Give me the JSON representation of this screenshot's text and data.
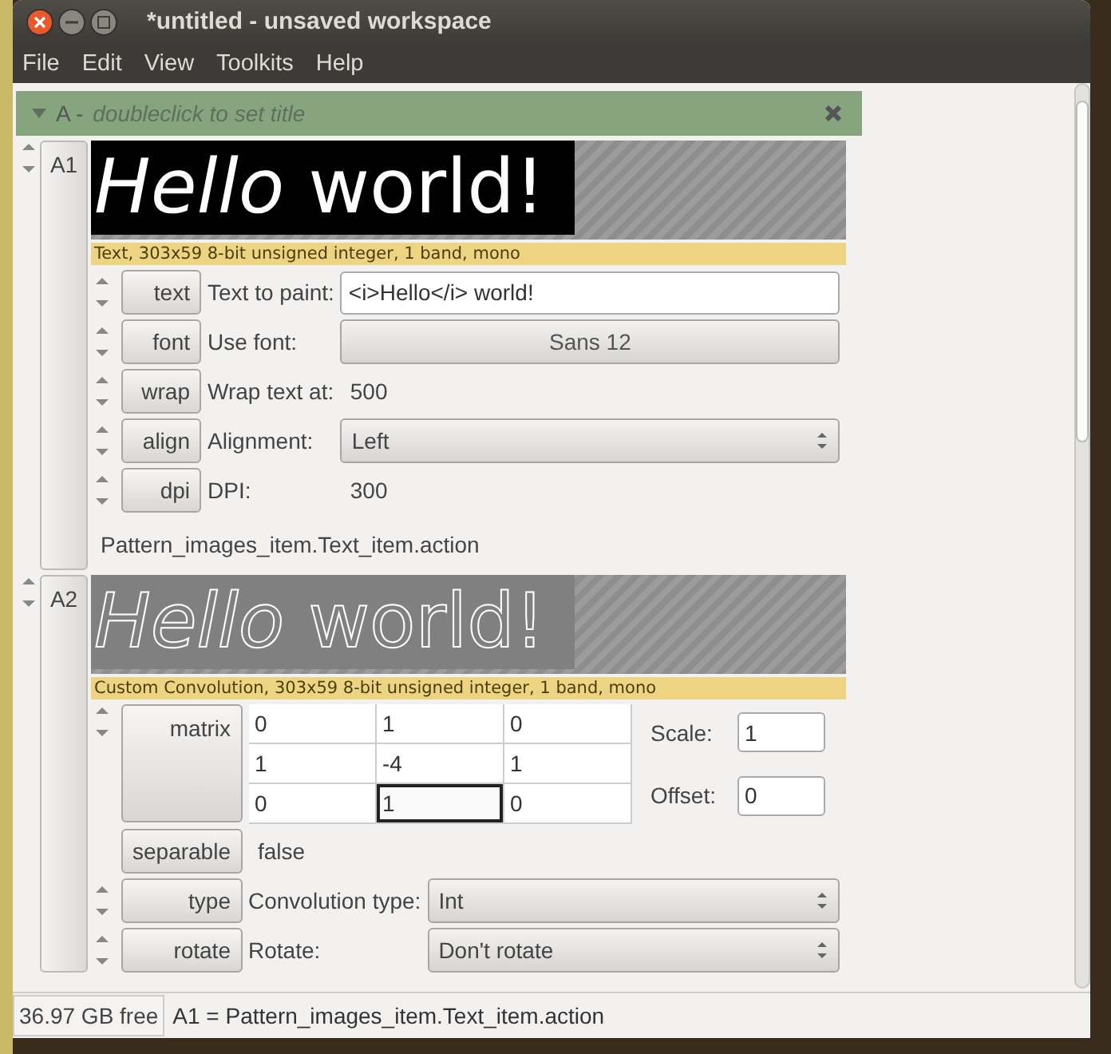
{
  "window": {
    "title": "*untitled - unsaved workspace"
  },
  "menu": [
    "File",
    "Edit",
    "View",
    "Toolkits",
    "Help"
  ],
  "workspace": {
    "prefix": "A -",
    "title_placeholder": "doubleclick to set title"
  },
  "items": [
    {
      "id_label": "A1",
      "kind": "solid",
      "image_text": "*Hello* world!",
      "caption": "Text, 303x59 8-bit unsigned integer, 1 band, mono",
      "params": [
        {
          "kind": "entry",
          "button": "text",
          "label": "Text to paint:",
          "value": "<i>Hello</i> world!"
        },
        {
          "kind": "fontbutton",
          "button": "font",
          "label": "Use font:",
          "value": "Sans 12"
        },
        {
          "kind": "value",
          "button": "wrap",
          "label": "Wrap text at:",
          "value": "500"
        },
        {
          "kind": "combo",
          "button": "align",
          "label": "Alignment:",
          "value": "Left"
        },
        {
          "kind": "value",
          "button": "dpi",
          "label": "DPI:",
          "value": "300"
        }
      ],
      "footer": "Pattern_images_item.Text_item.action"
    },
    {
      "id_label": "A2",
      "kind": "outline",
      "image_text": "*Hello* world!",
      "caption": "Custom Convolution, 303x59 8-bit unsigned integer, 1 band, mono",
      "params": [
        {
          "kind": "matrix",
          "button": "matrix",
          "cells": [
            [
              {
                "value": "0",
                "selected": false
              },
              {
                "value": "1",
                "selected": false
              },
              {
                "value": "0",
                "selected": false
              }
            ],
            [
              {
                "value": "1",
                "selected": false
              },
              {
                "value": "-4",
                "selected": false
              },
              {
                "value": "1",
                "selected": false
              }
            ],
            [
              {
                "value": "0",
                "selected": false
              },
              {
                "value": "1",
                "selected": true
              },
              {
                "value": "0",
                "selected": false
              }
            ]
          ],
          "fields": [
            {
              "label": "Scale:",
              "value": "1"
            },
            {
              "label": "Offset:",
              "value": "0"
            }
          ]
        },
        {
          "kind": "toggle",
          "button": "separable",
          "value": "false"
        },
        {
          "kind": "combo",
          "button": "type",
          "label": "Convolution type:",
          "value": "Int"
        },
        {
          "kind": "combo",
          "button": "rotate",
          "label": "Rotate:",
          "value": "Don't rotate"
        }
      ]
    }
  ],
  "status_bar": {
    "free": "36.97 GB free",
    "message": "A1 = Pattern_images_item.Text_item.action"
  }
}
